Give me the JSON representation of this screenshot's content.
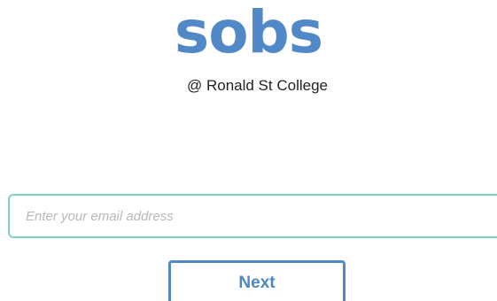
{
  "brand": {
    "logo_text": "sobs",
    "color": "#5189c8"
  },
  "school": {
    "label": "@ Ronald St College"
  },
  "login": {
    "email_placeholder": "Enter your email address",
    "email_value": "",
    "next_label": "Next",
    "input_border_color": "#7fd0cb"
  }
}
